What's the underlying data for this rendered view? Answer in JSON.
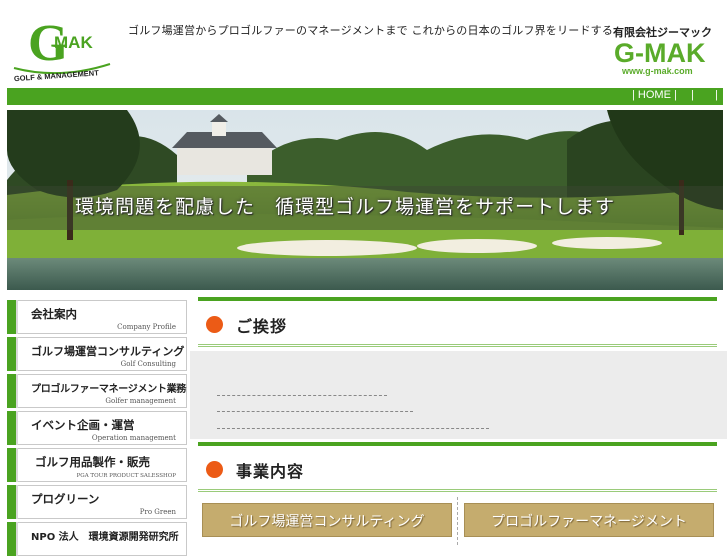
{
  "header": {
    "logo_letters": "G MAK",
    "logo_caption": "GOLF & MANAGEMENT",
    "tagline": "ゴルフ場運営からプロゴルファーのマネージメントまで これからの日本のゴルフ界をリードする",
    "company_name": "有限会社ジーマック",
    "brand": "G-MAK",
    "url": "www.g-mak.com"
  },
  "nav": {
    "home": "| HOME |",
    "sep1": "|",
    "sep2": "|"
  },
  "banner": {
    "headline": "環境問題を配慮した　循環型ゴルフ場運営をサポートします"
  },
  "sidebar": {
    "items": [
      {
        "title": "会社案内",
        "sub": "Company Profile"
      },
      {
        "title": "ゴルフ場運営コンサルティング",
        "sub": "Golf Consulting"
      },
      {
        "title": "プロゴルファーマネージメント業務",
        "sub": "Golfer management"
      },
      {
        "title": "イベント企画・運営",
        "sub": "Operation management"
      },
      {
        "title": "ゴルフ用品製作・販売",
        "sub": "PGA TOUR PRODUCT SALESSHOP"
      },
      {
        "title": "プログリーン",
        "sub": "Pro Green"
      },
      {
        "title": "NPO 法人　環境資源開発研究所",
        "sub": ""
      }
    ]
  },
  "main": {
    "greeting_heading": "ご挨拶",
    "business_heading": "事業内容",
    "buttons": {
      "golf_consulting": "ゴルフ場運営コンサルティング",
      "pro_management": "プロゴルファーマネージメント"
    }
  },
  "colors": {
    "brand_green": "#4aa320",
    "accent_orange": "#ec5b16",
    "button_gold": "#c5ac6e"
  }
}
